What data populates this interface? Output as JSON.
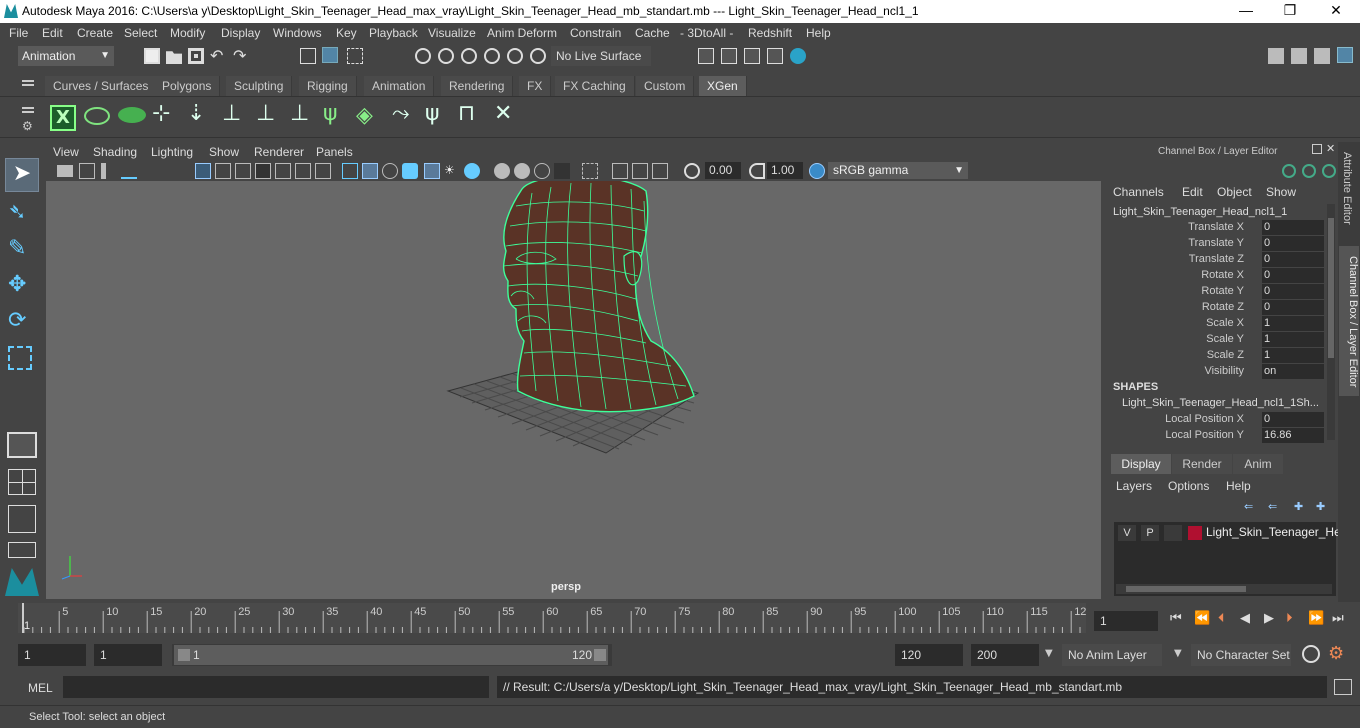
{
  "window": {
    "title": "Autodesk Maya 2016: C:\\Users\\a y\\Desktop\\Light_Skin_Teenager_Head_max_vray\\Light_Skin_Teenager_Head_mb_standart.mb   ---   Light_Skin_Teenager_Head_ncl1_1",
    "min": "—",
    "max": "❐",
    "close": "✕"
  },
  "menus": [
    "File",
    "Edit",
    "Create",
    "Select",
    "Modify",
    "Display",
    "Windows",
    "Key",
    "Playback",
    "Visualize",
    "Anim Deform",
    "Constrain",
    "Cache",
    "- 3DtoAll -",
    "Redshift",
    "Help"
  ],
  "statusline": {
    "mode": "Animation",
    "live_surface": "No Live Surface"
  },
  "shelf_tabs": [
    "Curves / Surfaces",
    "Polygons",
    "Sculpting",
    "Rigging",
    "Animation",
    "Rendering",
    "FX",
    "FX Caching",
    "Custom",
    "XGen"
  ],
  "active_shelf_tab": "XGen",
  "viewport": {
    "menus": [
      "View",
      "Shading",
      "Lighting",
      "Show",
      "Renderer",
      "Panels"
    ],
    "exposure": "0.00",
    "gamma": "1.00",
    "color_space": "sRGB gamma",
    "camera_label": "persp"
  },
  "channel_box": {
    "header": "Channel Box / Layer Editor",
    "menus": [
      "Channels",
      "Edit",
      "Object",
      "Show"
    ],
    "object_name": "Light_Skin_Teenager_Head_ncl1_1",
    "channels": [
      {
        "label": "Translate X",
        "value": "0"
      },
      {
        "label": "Translate Y",
        "value": "0"
      },
      {
        "label": "Translate Z",
        "value": "0"
      },
      {
        "label": "Rotate X",
        "value": "0"
      },
      {
        "label": "Rotate Y",
        "value": "0"
      },
      {
        "label": "Rotate Z",
        "value": "0"
      },
      {
        "label": "Scale X",
        "value": "1"
      },
      {
        "label": "Scale Y",
        "value": "1"
      },
      {
        "label": "Scale Z",
        "value": "1"
      },
      {
        "label": "Visibility",
        "value": "on"
      }
    ],
    "shapes_header": "SHAPES",
    "shape_name": "Light_Skin_Teenager_Head_ncl1_1Sh...",
    "shape_channels": [
      {
        "label": "Local Position X",
        "value": "0"
      },
      {
        "label": "Local Position Y",
        "value": "16.86"
      }
    ]
  },
  "layer_editor": {
    "tabs": [
      "Display",
      "Render",
      "Anim"
    ],
    "active_tab": "Display",
    "menus": [
      "Layers",
      "Options",
      "Help"
    ],
    "layer": {
      "v": "V",
      "p": "P",
      "name": "Light_Skin_Teenager_He",
      "color": "#b01030"
    }
  },
  "side_tabs": [
    "Attribute Editor",
    "Channel Box / Layer Editor"
  ],
  "timeline": {
    "ticks": [
      "5",
      "10",
      "15",
      "20",
      "25",
      "30",
      "35",
      "40",
      "45",
      "50",
      "55",
      "60",
      "65",
      "70",
      "75",
      "80",
      "85",
      "90",
      "95",
      "100",
      "105",
      "110",
      "115",
      "12"
    ],
    "start_label": "1",
    "current_frame": "1"
  },
  "range": {
    "start": "1",
    "anim_start": "1",
    "range_start": "1",
    "range_end": "120",
    "end": "120",
    "anim_end": "200",
    "anim_layer": "No Anim Layer",
    "char_set": "No Character Set"
  },
  "command": {
    "lang": "MEL",
    "result": "// Result: C:/Users/a y/Desktop/Light_Skin_Teenager_Head_max_vray/Light_Skin_Teenager_Head_mb_standart.mb"
  },
  "help_line": "Select Tool: select an object",
  "colors": {
    "wire": "#3dff9a",
    "skin": "#5a3326",
    "accent": "#5285a6"
  }
}
